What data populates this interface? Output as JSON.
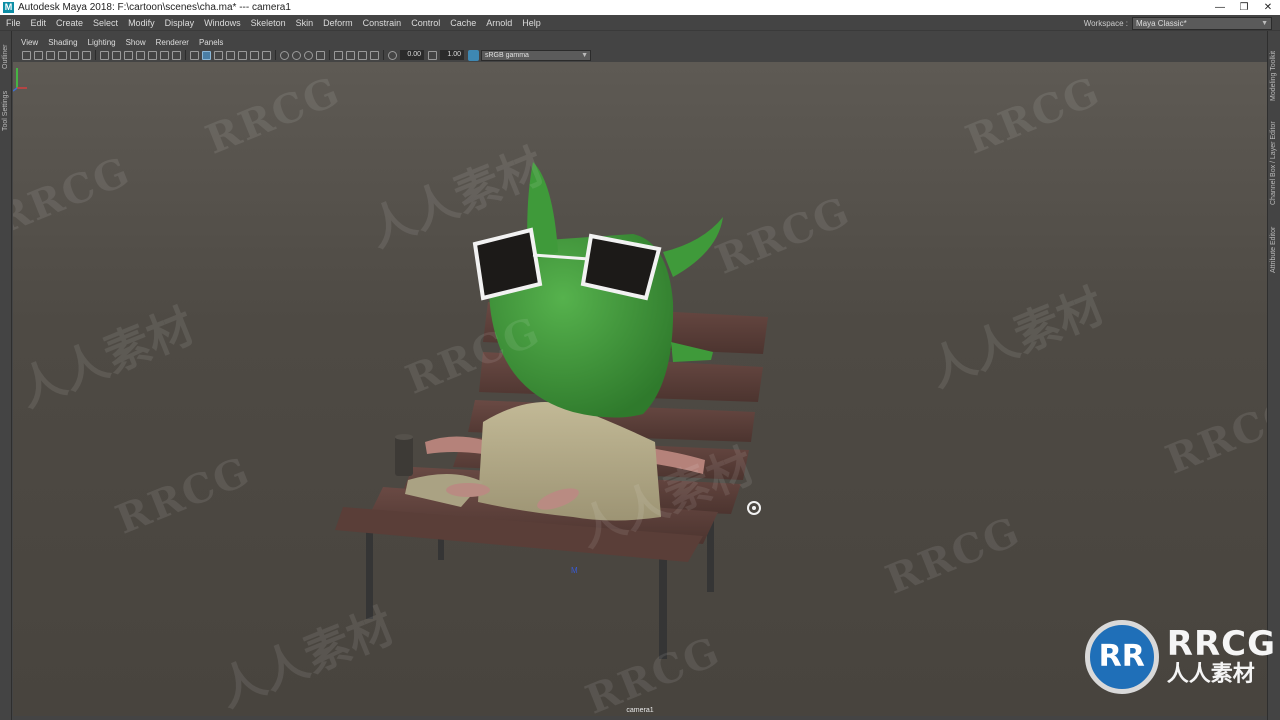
{
  "window": {
    "title": "Autodesk Maya 2018: F:\\cartoon\\scenes\\cha.ma*   ---   camera1",
    "app_icon": "M",
    "controls": [
      "—",
      "❐",
      "✕"
    ]
  },
  "menubar": {
    "items": [
      "File",
      "Edit",
      "Create",
      "Select",
      "Modify",
      "Display",
      "Windows",
      "Skeleton",
      "Skin",
      "Deform",
      "Constrain",
      "Control",
      "Cache",
      "Arnold",
      "Help"
    ],
    "workspace_label": "Workspace :",
    "workspace_value": "Maya Classic*"
  },
  "left_tabs": [
    "Outliner",
    "Tool Settings"
  ],
  "right_tabs": [
    "Modeling Toolkit",
    "Channel Box / Layer Editor",
    "Attribute Editor"
  ],
  "panel_menu": [
    "View",
    "Shading",
    "Lighting",
    "Show",
    "Renderer",
    "Panels"
  ],
  "panel_toolbar": {
    "exposure": "0.00",
    "gamma": "1.00",
    "color_space": "sRGB gamma"
  },
  "viewport": {
    "camera_label": "camera1",
    "pivot_label": "M",
    "watermark_en": "RRCG",
    "watermark_cn": "人人素材"
  },
  "logo": {
    "badge": "RR",
    "brand": "RRCG",
    "sub": "人人素材"
  },
  "colors": {
    "ui_bg": "#444444",
    "character_green": "#3f9a3a",
    "bench_wood": "#5a3e38",
    "towel": "#b6ae8c",
    "skin": "#c08a80",
    "logo_blue": "#1f6fb8"
  }
}
